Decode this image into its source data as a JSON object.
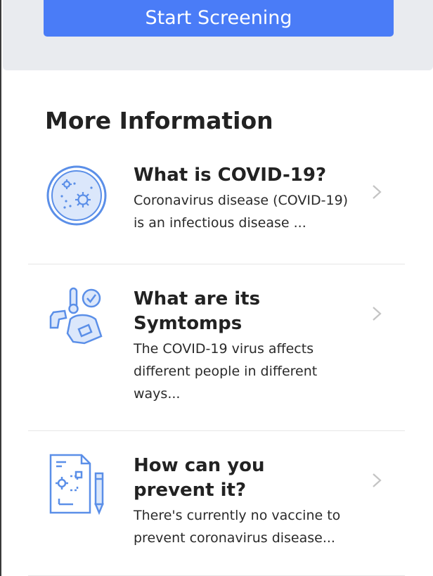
{
  "top": {
    "start_button_label": "Start Screening"
  },
  "section": {
    "title": "More Information"
  },
  "items": [
    {
      "title": "What is COVID-19?",
      "description": "Coronavirus disease (COVID-19) is an infectious disease ...",
      "icon": "virus-petri-dish-icon"
    },
    {
      "title": "What are its Symtomps",
      "description": "The COVID-19 virus affects different people in different ways...",
      "icon": "fever-thermometer-icon"
    },
    {
      "title": "How can you prevent it?",
      "description": "There's currently no vaccine to prevent coronavirus disease...",
      "icon": "prevention-plan-icon"
    }
  ],
  "colors": {
    "accent": "#4a7cf7",
    "icon_blue": "#5b8fe8",
    "panel_gray": "#e9ebef",
    "chevron": "#c4c4c4"
  }
}
